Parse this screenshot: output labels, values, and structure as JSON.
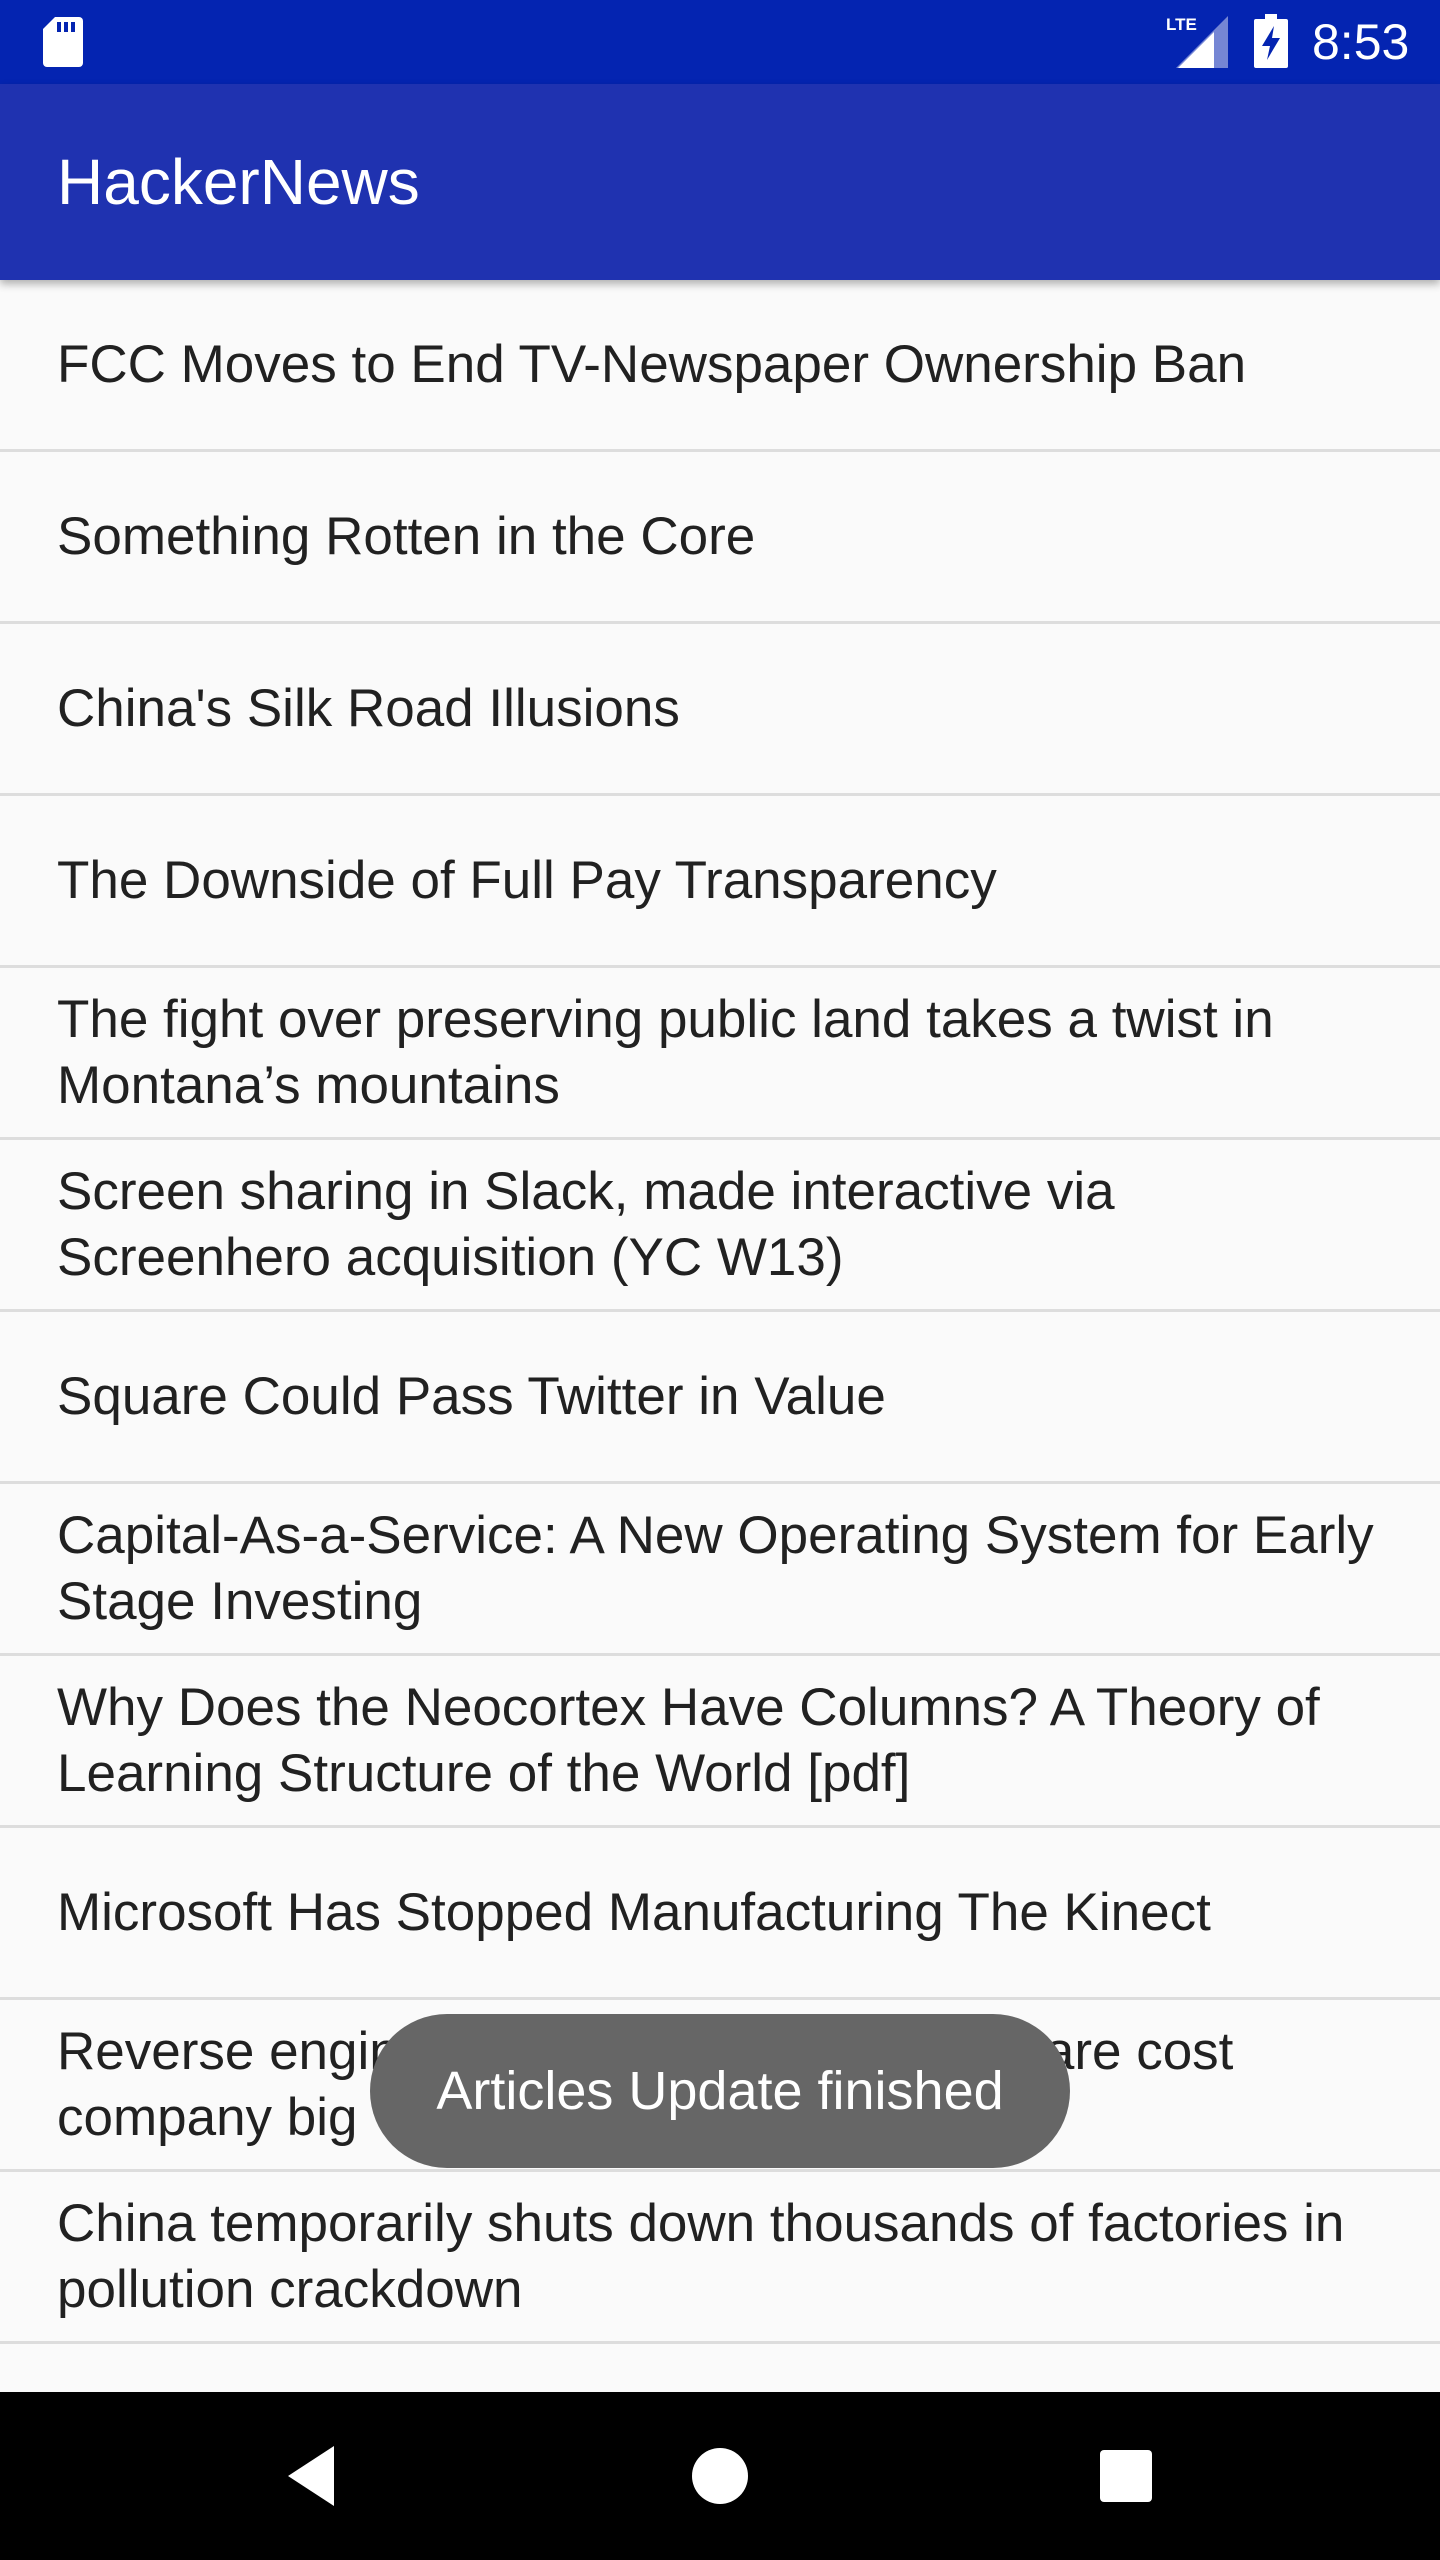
{
  "status_bar": {
    "time": "8:53",
    "network_label": "LTE",
    "icons": [
      "sd-card-icon",
      "lte-signal-icon",
      "battery-charging-icon"
    ],
    "background": "#0424b1"
  },
  "app_bar": {
    "title": "HackerNews",
    "background": "#1f32b0"
  },
  "articles": [
    {
      "title": "FCC Moves to End TV-Newspaper Ownership Ban"
    },
    {
      "title": "Something Rotten in the Core"
    },
    {
      "title": "China's Silk Road Illusions"
    },
    {
      "title": "The Downside of Full Pay Transparency"
    },
    {
      "title": "The fight over preserving public land takes a twist in Montana’s mountains"
    },
    {
      "title": "Screen sharing in Slack, made interactive via Screenhero acquisition (YC W13)"
    },
    {
      "title": "Square Could Pass Twitter in Value"
    },
    {
      "title": "Capital-As-a-Service: A New Operating System for Early Stage Investing"
    },
    {
      "title": "Why Does the Neocortex Have Columns? A Theory of Learning Structure of the World [pdf]"
    },
    {
      "title": "Microsoft Has Stopped Manufacturing The Kinect"
    },
    {
      "title": "Reverse engineering of competitor’s software cost company big"
    },
    {
      "title": "China temporarily shuts down thousands of factories in pollution crackdown"
    }
  ],
  "toast": {
    "message": "Articles Update finished"
  },
  "nav_bar": {
    "buttons": [
      "back-icon",
      "home-icon",
      "recents-icon"
    ]
  }
}
